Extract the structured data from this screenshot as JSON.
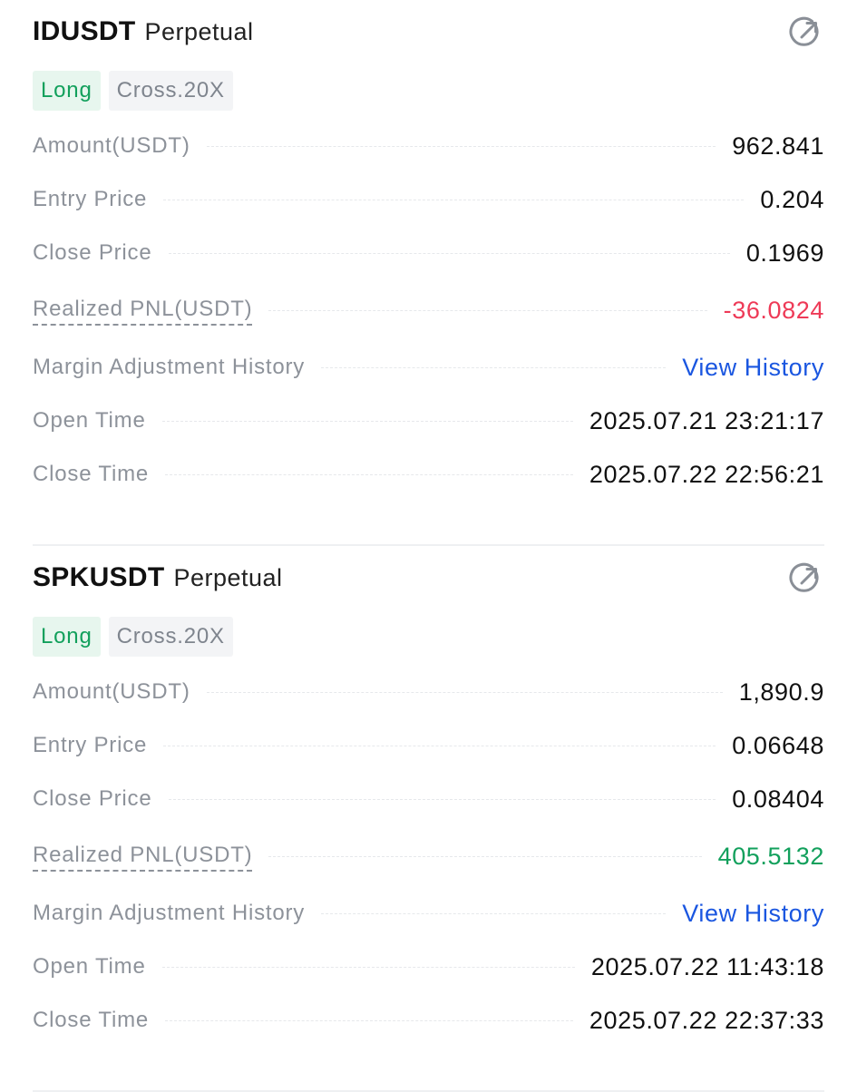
{
  "colors": {
    "long_tag_text": "#12a05c",
    "long_tag_bg": "#e7f6ee",
    "negative": "#ee3a57",
    "positive": "#12a05c",
    "link": "#1a56e0",
    "label": "#8d929a"
  },
  "positions": [
    {
      "symbol": "IDUSDT",
      "type": "Perpetual",
      "share_icon": "share-arrow-icon",
      "side": "Long",
      "margin_mode": "Cross.20X",
      "amount_label": "Amount(USDT)",
      "amount": "962.841",
      "entry_label": "Entry Price",
      "entry_price": "0.204",
      "close_label": "Close Price",
      "close_price": "0.1969",
      "pnl_label": "Realized PNL(USDT)",
      "pnl": "-36.0824",
      "pnl_sign": "negative",
      "margin_history_label": "Margin Adjustment History",
      "margin_history_link": "View History",
      "open_time_label": "Open Time",
      "open_time": "2025.07.21 23:21:17",
      "close_time_label": "Close Time",
      "close_time": "2025.07.22 22:56:21"
    },
    {
      "symbol": "SPKUSDT",
      "type": "Perpetual",
      "share_icon": "share-arrow-icon",
      "side": "Long",
      "margin_mode": "Cross.20X",
      "amount_label": "Amount(USDT)",
      "amount": "1,890.9",
      "entry_label": "Entry Price",
      "entry_price": "0.06648",
      "close_label": "Close Price",
      "close_price": "0.08404",
      "pnl_label": "Realized PNL(USDT)",
      "pnl": "405.5132",
      "pnl_sign": "positive",
      "margin_history_label": "Margin Adjustment History",
      "margin_history_link": "View History",
      "open_time_label": "Open Time",
      "open_time": "2025.07.22 11:43:18",
      "close_time_label": "Close Time",
      "close_time": "2025.07.22 22:37:33"
    }
  ]
}
